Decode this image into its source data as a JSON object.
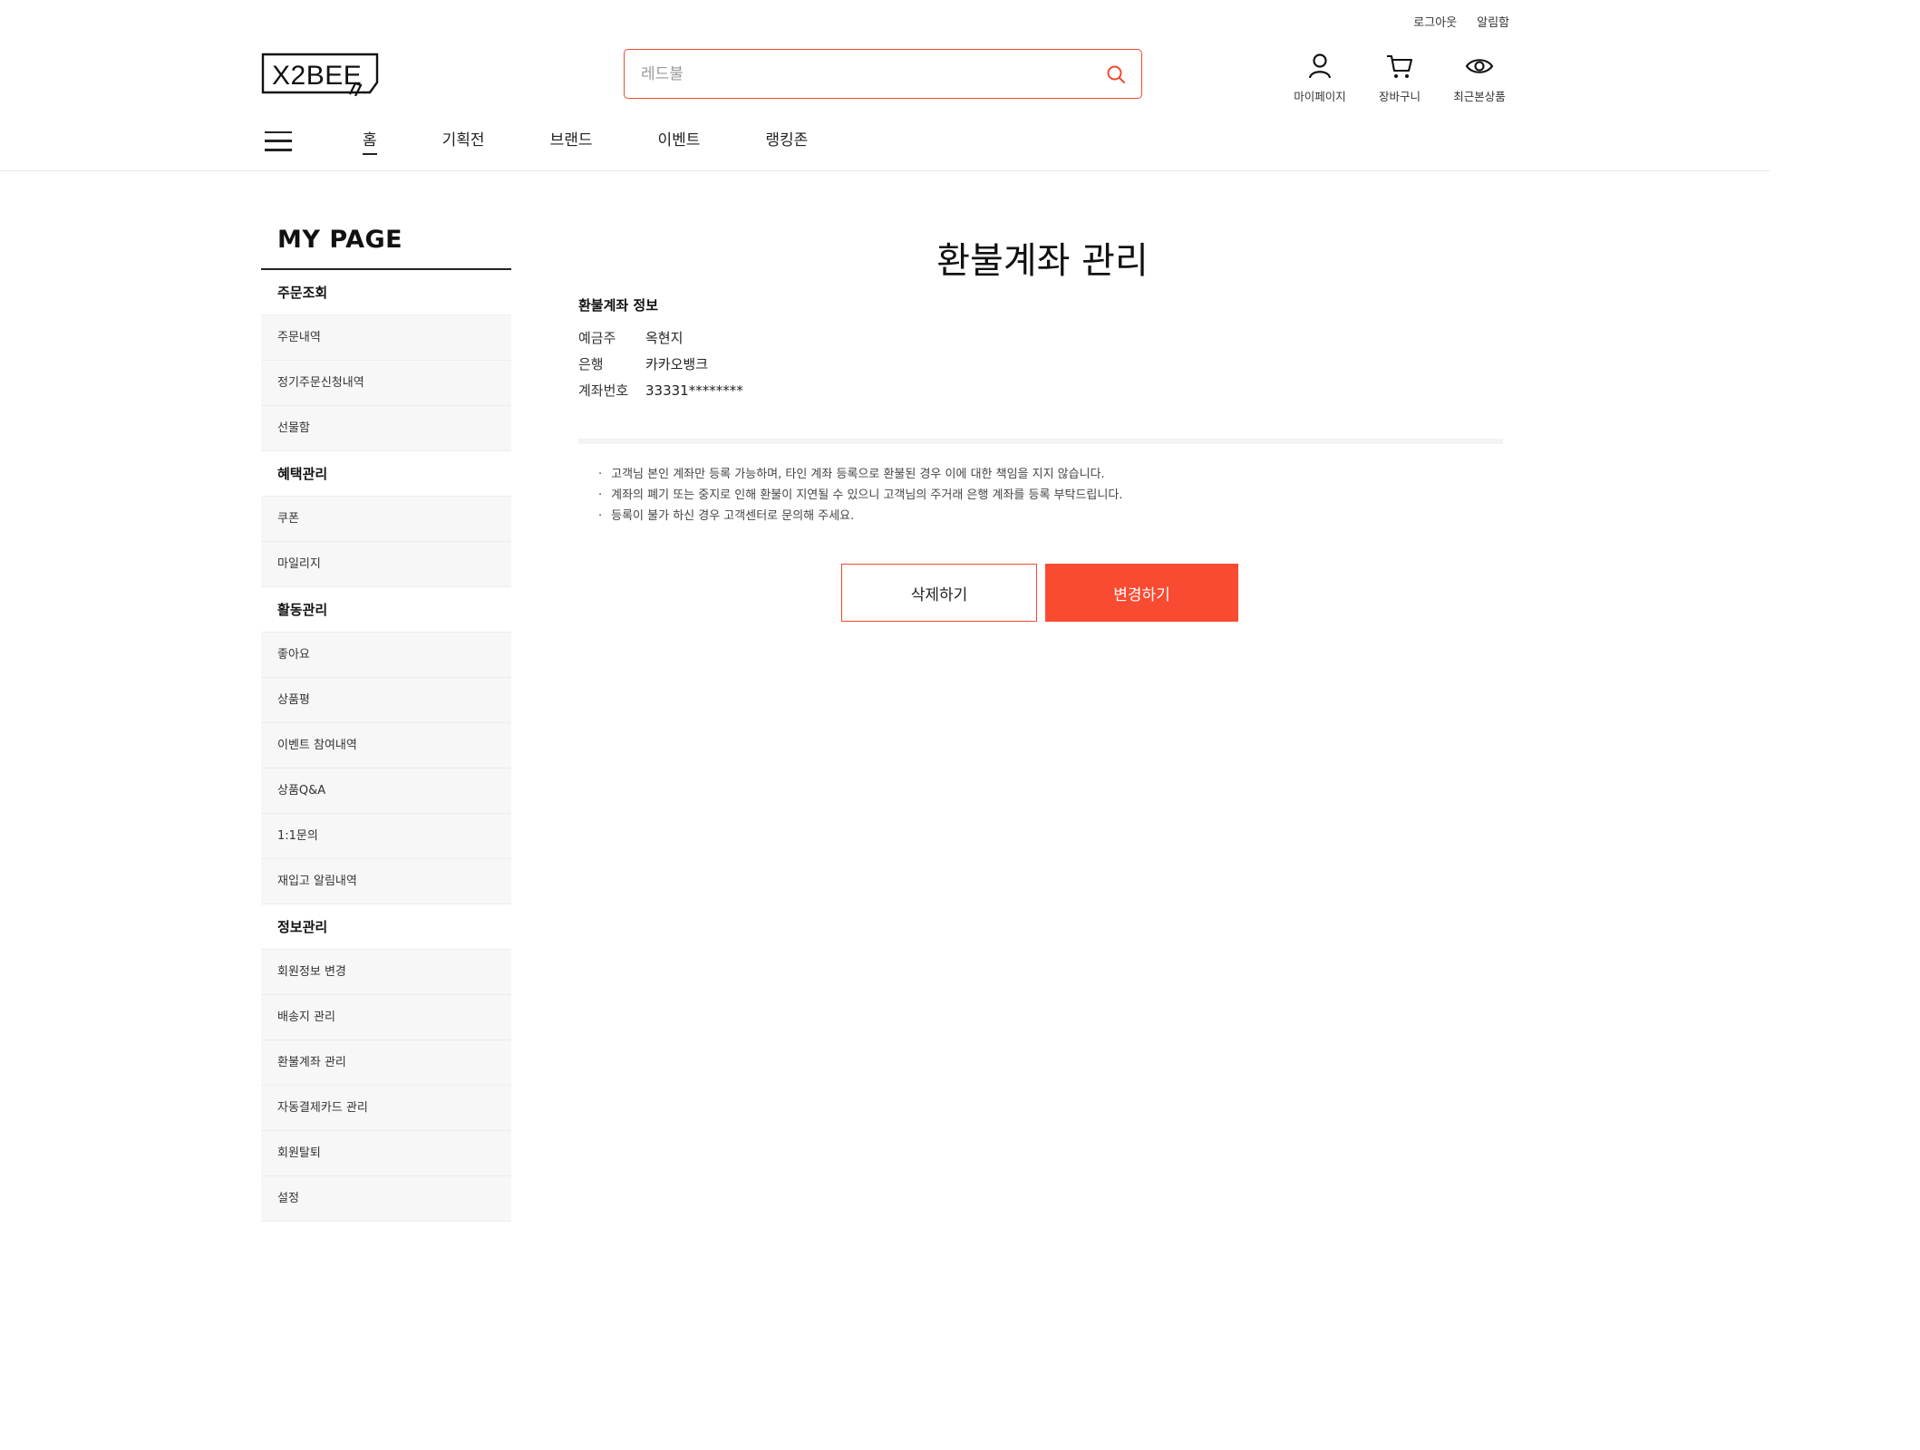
{
  "header": {
    "top_links": {
      "logout": "로그아웃",
      "notifications": "알림함"
    },
    "logo_text": "X2BEE",
    "search": {
      "placeholder": "레드불",
      "value": ""
    },
    "utils": {
      "mypage": "마이페이지",
      "cart": "장바구니",
      "recent": "최근본상품"
    },
    "gnb": [
      "홈",
      "기획전",
      "브랜드",
      "이벤트",
      "랭킹존"
    ]
  },
  "sidebar": {
    "title": "MY PAGE",
    "groups": [
      {
        "label": "주문조회",
        "items": [
          "주문내역",
          "정기주문신청내역",
          "선물함"
        ]
      },
      {
        "label": "혜택관리",
        "items": [
          "쿠폰",
          "마일리지"
        ]
      },
      {
        "label": "활동관리",
        "items": [
          "좋아요",
          "상품평",
          "이벤트 참여내역",
          "상품Q&A",
          "1:1문의",
          "재입고 알림내역"
        ]
      },
      {
        "label": "정보관리",
        "items": [
          "회원정보 변경",
          "배송지 관리",
          "환불계좌 관리",
          "자동결제카드 관리",
          "회원탈퇴",
          "설정"
        ]
      }
    ]
  },
  "main": {
    "title": "환불계좌 관리",
    "info": {
      "heading": "환불계좌 정보",
      "rows": [
        {
          "label": "예금주",
          "value": "옥현지"
        },
        {
          "label": "은행",
          "value": "카카오뱅크"
        },
        {
          "label": "계좌번호",
          "value": "33331********"
        }
      ]
    },
    "notices": [
      "고객님 본인 계좌만 등록 가능하며, 타인 계좌 등록으로 환불된 경우 이에 대한 책임을 지지 않습니다.",
      "계좌의 폐기 또는 중지로 인해 환불이 지연될 수 있으니 고객님의 주거래 은행 계좌를 등록 부탁드립니다.",
      "등록이 불가 하신 경우 고객센터로 문의해 주세요."
    ],
    "buttons": {
      "delete": "삭제하기",
      "change": "변경하기"
    }
  },
  "colors": {
    "accent": "#f94a32",
    "accent_border": "#f04a2f",
    "sidebar_bg": "#f7f7f7"
  }
}
